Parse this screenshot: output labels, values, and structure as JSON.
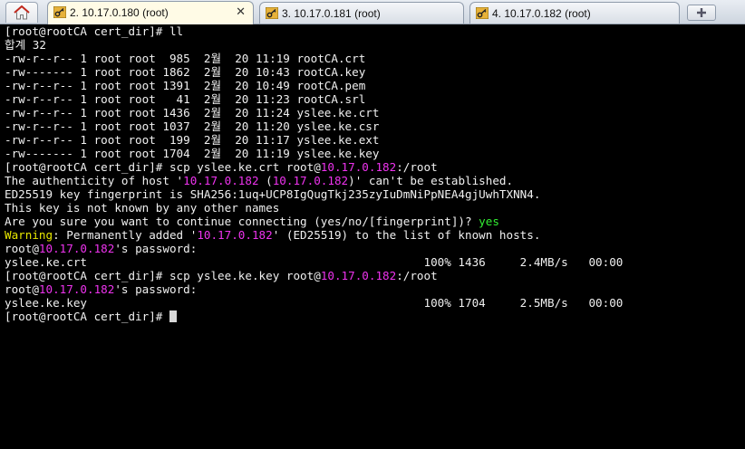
{
  "tabs": [
    {
      "label": "2. 10.17.0.180 (root)",
      "active": true
    },
    {
      "label": "3. 10.17.0.181 (root)",
      "active": false
    },
    {
      "label": "4. 10.17.0.182 (root)",
      "active": false
    }
  ],
  "colors": {
    "ip": "#ee33ee",
    "yes": "#33ee33",
    "warning": "#e8e800",
    "text": "#f0f0f0",
    "background": "#000000"
  },
  "terminal": {
    "l1": "[root@rootCA cert_dir]# ll",
    "l2": "합계 32",
    "l3": "-rw-r--r-- 1 root root  985  2월  20 11:19 rootCA.crt",
    "l4": "-rw------- 1 root root 1862  2월  20 10:43 rootCA.key",
    "l5": "-rw-r--r-- 1 root root 1391  2월  20 10:49 rootCA.pem",
    "l6": "-rw-r--r-- 1 root root   41  2월  20 11:23 rootCA.srl",
    "l7": "-rw-r--r-- 1 root root 1436  2월  20 11:24 yslee.ke.crt",
    "l8": "-rw-r--r-- 1 root root 1037  2월  20 11:20 yslee.ke.csr",
    "l9": "-rw-r--r-- 1 root root  199  2월  20 11:17 yslee.ke.ext",
    "l10": "-rw------- 1 root root 1704  2월  20 11:19 yslee.ke.key",
    "l11a": "[root@rootCA cert_dir]# scp yslee.ke.crt root@",
    "l11ip": "10.17.0.182",
    "l11b": ":/root",
    "l12a": "The authenticity of host '",
    "l12ip1": "10.17.0.182",
    "l12b": " (",
    "l12ip2": "10.17.0.182",
    "l12c": ")' can't be established.",
    "l13": "ED25519 key fingerprint is SHA256:1uq+UCP8IgQugTkj235zyIuDmNiPpNEA4gjUwhTXNN4.",
    "l14": "This key is not known by any other names",
    "l15a": "Are you sure you want to continue connecting (yes/no/[fingerprint])? ",
    "l15yes": "yes",
    "l16warn": "Warning",
    "l16a": ": Permanently added '",
    "l16ip": "10.17.0.182",
    "l16b": "' (ED25519) to the list of known hosts.",
    "l17a": "root@",
    "l17ip": "10.17.0.182",
    "l17b": "'s password:",
    "l18": "yslee.ke.crt                                                 100% 1436     2.4MB/s   00:00",
    "l19a": "[root@rootCA cert_dir]# scp yslee.ke.key root@",
    "l19ip": "10.17.0.182",
    "l19b": ":/root",
    "l20a": "root@",
    "l20ip": "10.17.0.182",
    "l20b": "'s password:",
    "l21": "yslee.ke.key                                                 100% 1704     2.5MB/s   00:00",
    "l22": "[root@rootCA cert_dir]# "
  }
}
